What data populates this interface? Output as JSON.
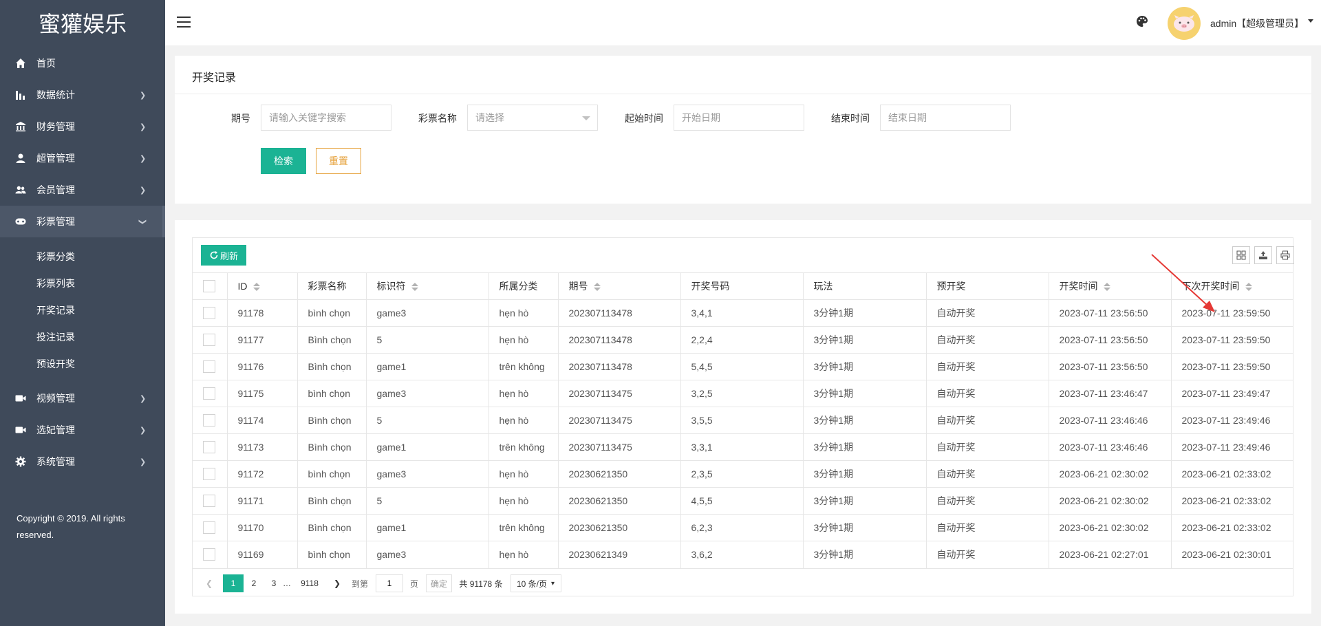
{
  "app": {
    "logo": "蜜獾娱乐"
  },
  "sidebar": {
    "items": [
      {
        "label": "首页",
        "icon": "home-icon"
      },
      {
        "label": "数据统计",
        "icon": "bar-chart-icon"
      },
      {
        "label": "财务管理",
        "icon": "bank-icon"
      },
      {
        "label": "超管管理",
        "icon": "user-icon"
      },
      {
        "label": "会员管理",
        "icon": "users-icon"
      },
      {
        "label": "彩票管理",
        "icon": "gamepad-icon"
      },
      {
        "label": "视频管理",
        "icon": "video-icon"
      },
      {
        "label": "选妃管理",
        "icon": "video-icon"
      },
      {
        "label": "系统管理",
        "icon": "gear-icon"
      }
    ],
    "subitems": [
      {
        "label": "彩票分类"
      },
      {
        "label": "彩票列表"
      },
      {
        "label": "开奖记录"
      },
      {
        "label": "投注记录"
      },
      {
        "label": "预设开奖"
      }
    ],
    "copyright": "Copyright © 2019. All rights reserved."
  },
  "header": {
    "user": "admin【超级管理员】"
  },
  "search": {
    "title": "开奖记录",
    "period_label": "期号",
    "period_placeholder": "请输入关键字搜索",
    "lottery_label": "彩票名称",
    "lottery_value": "请选择",
    "start_label": "起始时间",
    "start_placeholder": "开始日期",
    "end_label": "结束时间",
    "end_placeholder": "结束日期",
    "search_btn": "检索",
    "reset_btn": "重置"
  },
  "table": {
    "refresh_btn": "刷新",
    "columns": [
      "ID",
      "彩票名称",
      "标识符",
      "所属分类",
      "期号",
      "开奖号码",
      "玩法",
      "预开奖",
      "开奖时间",
      "下次开奖时间"
    ],
    "rows": [
      [
        "91178",
        "bình chọn",
        "game3",
        "hẹn hò",
        "202307113478",
        "3,4,1",
        "3分钟1期",
        "自动开奖",
        "2023-07-11 23:56:50",
        "2023-07-11 23:59:50"
      ],
      [
        "91177",
        "Bình chọn",
        "5",
        "hẹn hò",
        "202307113478",
        "2,2,4",
        "3分钟1期",
        "自动开奖",
        "2023-07-11 23:56:50",
        "2023-07-11 23:59:50"
      ],
      [
        "91176",
        "Bình chọn",
        "game1",
        "trên không",
        "202307113478",
        "5,4,5",
        "3分钟1期",
        "自动开奖",
        "2023-07-11 23:56:50",
        "2023-07-11 23:59:50"
      ],
      [
        "91175",
        "bình chọn",
        "game3",
        "hẹn hò",
        "202307113475",
        "3,2,5",
        "3分钟1期",
        "自动开奖",
        "2023-07-11 23:46:47",
        "2023-07-11 23:49:47"
      ],
      [
        "91174",
        "Bình chọn",
        "5",
        "hẹn hò",
        "202307113475",
        "3,5,5",
        "3分钟1期",
        "自动开奖",
        "2023-07-11 23:46:46",
        "2023-07-11 23:49:46"
      ],
      [
        "91173",
        "Bình chọn",
        "game1",
        "trên không",
        "202307113475",
        "3,3,1",
        "3分钟1期",
        "自动开奖",
        "2023-07-11 23:46:46",
        "2023-07-11 23:49:46"
      ],
      [
        "91172",
        "bình chọn",
        "game3",
        "hẹn hò",
        "20230621350",
        "2,3,5",
        "3分钟1期",
        "自动开奖",
        "2023-06-21 02:30:02",
        "2023-06-21 02:33:02"
      ],
      [
        "91171",
        "Bình chọn",
        "5",
        "hẹn hò",
        "20230621350",
        "4,5,5",
        "3分钟1期",
        "自动开奖",
        "2023-06-21 02:30:02",
        "2023-06-21 02:33:02"
      ],
      [
        "91170",
        "Bình chọn",
        "game1",
        "trên không",
        "20230621350",
        "6,2,3",
        "3分钟1期",
        "自动开奖",
        "2023-06-21 02:30:02",
        "2023-06-21 02:33:02"
      ],
      [
        "91169",
        "bình chọn",
        "game3",
        "hẹn hò",
        "20230621349",
        "3,6,2",
        "3分钟1期",
        "自动开奖",
        "2023-06-21 02:27:01",
        "2023-06-21 02:30:01"
      ]
    ]
  },
  "pager": {
    "pages": [
      "1",
      "2",
      "3",
      "…",
      "9118"
    ],
    "goto_label": "到第",
    "goto_value": "1",
    "page_unit": "页",
    "confirm": "确定",
    "total": "共 91178 条",
    "page_size": "10 条/页"
  },
  "colors": {
    "accent": "#1bb394",
    "warning": "#e6a23c",
    "sidebar": "#3f4a5a",
    "annotation": "#e53935"
  }
}
